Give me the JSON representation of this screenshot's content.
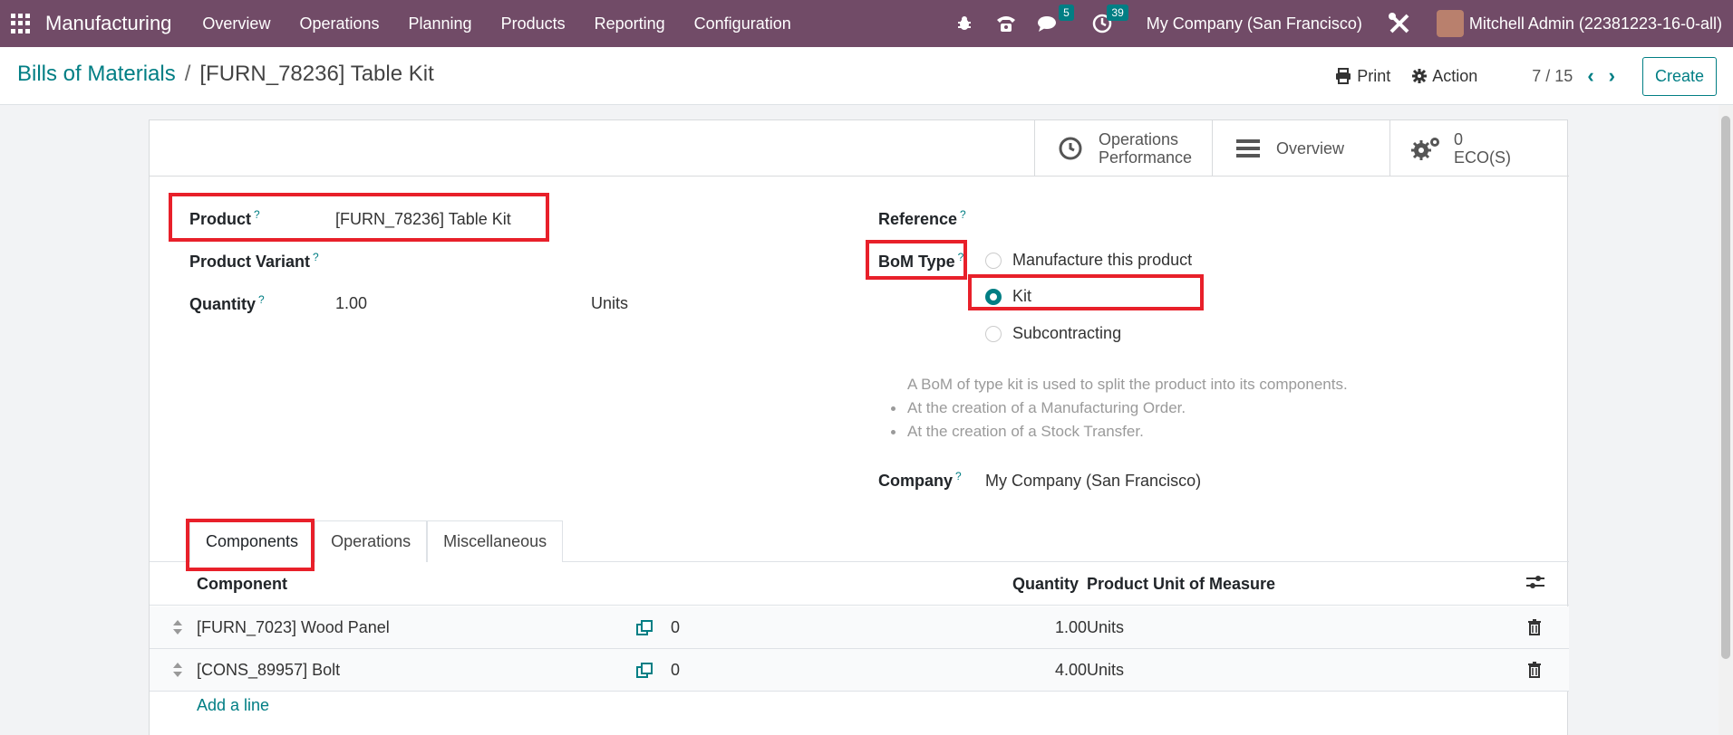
{
  "navbar": {
    "app_name": "Manufacturing",
    "menu": [
      "Overview",
      "Operations",
      "Planning",
      "Products",
      "Reporting",
      "Configuration"
    ],
    "messages_count": "5",
    "activities_count": "39",
    "company": "My Company (San Francisco)",
    "user": "Mitchell Admin (22381223-16-0-all)"
  },
  "breadcrumb": {
    "parent": "Bills of Materials",
    "separator": "/",
    "current": "[FURN_78236] Table Kit"
  },
  "control": {
    "print_label": "Print",
    "action_label": "Action",
    "pager": "7 / 15",
    "create_label": "Create"
  },
  "smart_buttons": {
    "operations_line1": "Operations",
    "operations_line2": "Performance",
    "overview": "Overview",
    "eco_count": "0",
    "eco_label": "ECO(S)"
  },
  "form": {
    "product_label": "Product",
    "product_value": "[FURN_78236] Table Kit",
    "variant_label": "Product Variant",
    "quantity_label": "Quantity",
    "quantity_value": "1.00",
    "quantity_uom": "Units",
    "reference_label": "Reference",
    "bom_type_label": "BoM Type",
    "bom_type_options": [
      "Manufacture this product",
      "Kit",
      "Subcontracting"
    ],
    "bom_type_selected": "Kit",
    "kit_note": "A BoM of type kit is used to split the product into its components.",
    "kit_bullets": [
      "At the creation of a Manufacturing Order.",
      "At the creation of a Stock Transfer."
    ],
    "company_label": "Company",
    "company_value": "My Company (San Francisco)",
    "help_mark": "?"
  },
  "tabs": [
    "Components",
    "Operations",
    "Miscellaneous"
  ],
  "table": {
    "columns": [
      "Component",
      "Quantity",
      "Product Unit of Measure"
    ],
    "rows": [
      {
        "component": "[FURN_7023] Wood Panel",
        "forecast": "0",
        "quantity": "1.00",
        "uom": "Units"
      },
      {
        "component": "[CONS_89957] Bolt",
        "forecast": "0",
        "quantity": "4.00",
        "uom": "Units"
      }
    ],
    "add_line": "Add a line"
  },
  "colors": {
    "navbar": "#714b67",
    "accent": "#017e84",
    "highlight": "#e8202a"
  }
}
